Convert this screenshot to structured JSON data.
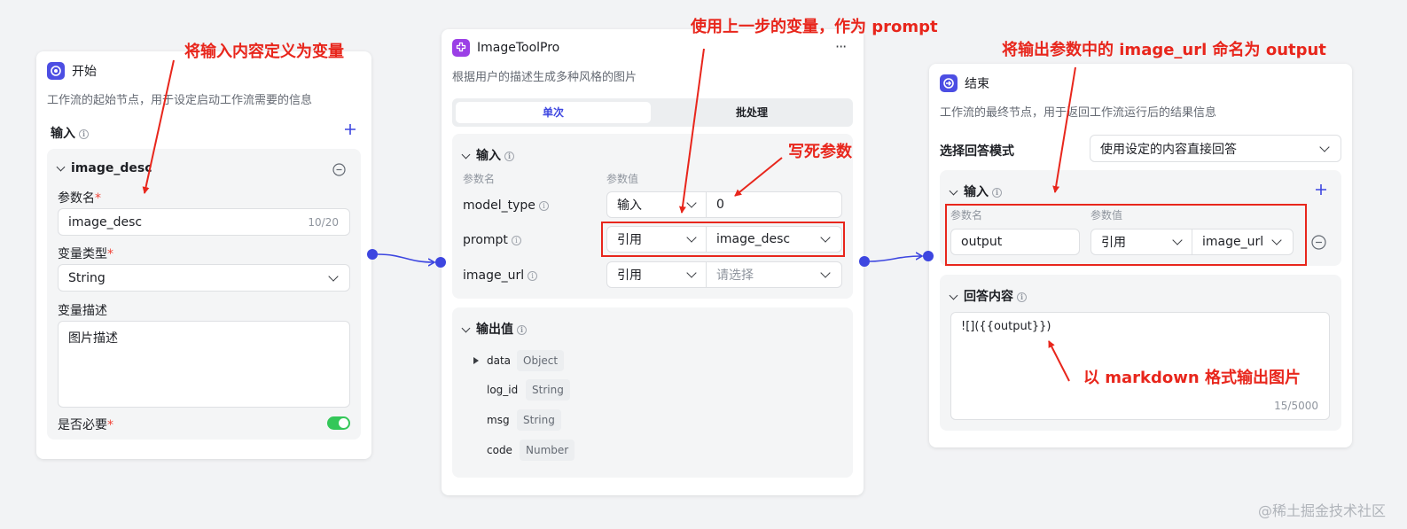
{
  "start_node": {
    "title": "开始",
    "description": "工作流的起始节点，用于设定启动工作流需要的信息",
    "input_label": "输入",
    "variable": {
      "name": "image_desc",
      "param_name_label": "参数名",
      "param_name_value": "image_desc",
      "param_name_count": "10/20",
      "type_label": "变量类型",
      "type_value": "String",
      "desc_label": "变量描述",
      "desc_value": "图片描述",
      "required_label": "是否必要",
      "required_on": true
    }
  },
  "tool_node": {
    "title": "ImageToolPro",
    "description": "根据用户的描述生成多种风格的图片",
    "more": "···",
    "tabs": [
      "单次",
      "批处理"
    ],
    "input_label": "输入",
    "col_name": "参数名",
    "col_value": "参数值",
    "params": [
      {
        "name": "model_type",
        "mode": "输入",
        "value": "0"
      },
      {
        "name": "prompt",
        "mode": "引用",
        "value": "image_desc"
      },
      {
        "name": "image_url",
        "mode": "引用",
        "value": "请选择"
      }
    ],
    "output_label": "输出值",
    "outputs": [
      {
        "name": "data",
        "type": "Object"
      },
      {
        "name": "log_id",
        "type": "String"
      },
      {
        "name": "msg",
        "type": "String"
      },
      {
        "name": "code",
        "type": "Number"
      }
    ]
  },
  "end_node": {
    "title": "结束",
    "description": "工作流的最终节点，用于返回工作流运行后的结果信息",
    "mode_label": "选择回答模式",
    "mode_value": "使用设定的内容直接回答",
    "input_label": "输入",
    "col_name": "参数名",
    "col_value": "参数值",
    "param_name": "output",
    "param_mode": "引用",
    "param_value": "image_url",
    "answer_label": "回答内容",
    "answer_value": "![]({{output}})",
    "answer_count": "15/5000"
  },
  "annotations": {
    "a1": "将输入内容定义为变量",
    "a2": "使用上一步的变量，作为 prompt",
    "a3": "写死参数",
    "a4": "将输出参数中的 image_url 命名为 output",
    "a5": "以 markdown 格式输出图片"
  },
  "watermark": "@稀土掘金技术社区",
  "colors": {
    "accent": "#3d46e0",
    "annotation": "#e8261c",
    "toggle": "#34c759"
  }
}
